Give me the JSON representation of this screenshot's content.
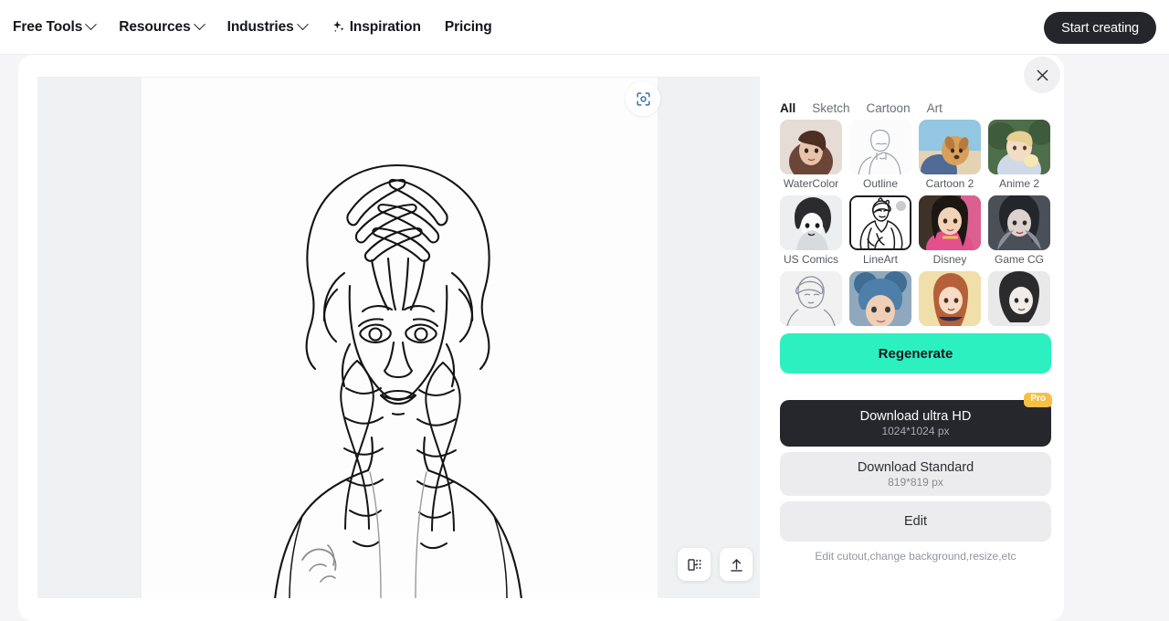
{
  "topbar": {
    "nav": [
      {
        "label": "Free Tools",
        "caret": true,
        "icon": null
      },
      {
        "label": "Resources",
        "caret": true,
        "icon": null
      },
      {
        "label": "Industries",
        "caret": true,
        "icon": null
      },
      {
        "label": "Inspiration",
        "caret": false,
        "icon": "sparkles-icon"
      },
      {
        "label": "Pricing",
        "caret": false,
        "icon": null
      }
    ],
    "cta_label": "Start creating"
  },
  "modal": {
    "close_icon": "close-icon"
  },
  "canvas": {
    "scan_icon": "scan-focus-icon",
    "tools": [
      {
        "name": "compare-split-view-button",
        "icon": "compare-icon"
      },
      {
        "name": "upload-button",
        "icon": "upload-icon"
      }
    ],
    "artwork_alt": "line-art portrait of a girl with braided hair"
  },
  "panel": {
    "tabs": [
      {
        "label": "All",
        "active": true
      },
      {
        "label": "Sketch",
        "active": false
      },
      {
        "label": "Cartoon",
        "active": false
      },
      {
        "label": "Art",
        "active": false
      }
    ],
    "styles": [
      [
        {
          "label": "WaterColor",
          "selected": false
        },
        {
          "label": "Outline",
          "selected": false
        },
        {
          "label": "Cartoon 2",
          "selected": false
        },
        {
          "label": "Anime 2",
          "selected": false
        }
      ],
      [
        {
          "label": "US Comics",
          "selected": false
        },
        {
          "label": "LineArt",
          "selected": true
        },
        {
          "label": "Disney",
          "selected": false
        },
        {
          "label": "Game CG",
          "selected": false
        }
      ],
      [
        {
          "label": "",
          "selected": false
        },
        {
          "label": "",
          "selected": false
        },
        {
          "label": "",
          "selected": false
        },
        {
          "label": "",
          "selected": false
        }
      ]
    ],
    "regenerate_label": "Regenerate",
    "download_ultra": {
      "title": "Download ultra HD",
      "subtitle": "1024*1024 px",
      "badge": "Pro"
    },
    "download_standard": {
      "title": "Download Standard",
      "subtitle": "819*819 px"
    },
    "edit_label": "Edit",
    "edit_hint": "Edit cutout,change background,resize,etc"
  },
  "colors": {
    "accent": "#2df0c0",
    "dark": "#26272c",
    "pro_badge": "#f5c045",
    "panel_bg": "#ffffff",
    "page_bg": "#f5f5f7"
  }
}
